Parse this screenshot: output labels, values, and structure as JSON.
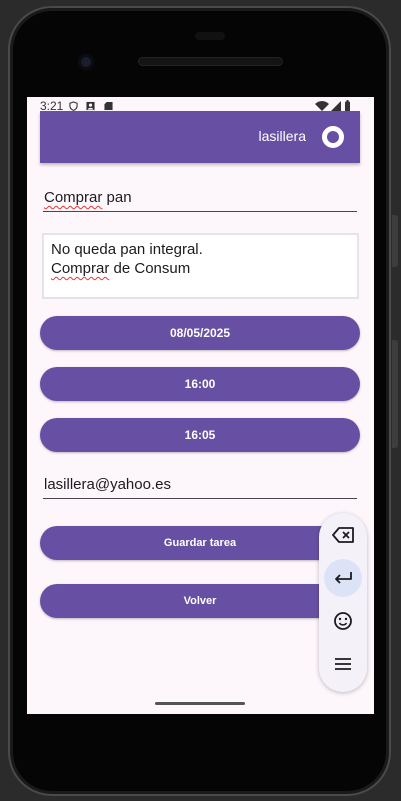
{
  "status_bar": {
    "time": "3:21"
  },
  "app_bar": {
    "username": "lasillera"
  },
  "form": {
    "title_word1": "Comprar",
    "title_word2": " pan",
    "notes_line1": "No queda pan integral.",
    "notes_line2_word1": "Comprar",
    "notes_line2_rest": " de Consum",
    "date": "08/05/2025",
    "time_start": "16:00",
    "time_end": "16:05",
    "email": "lasillera@yahoo.es"
  },
  "actions": {
    "save_label": "Guardar tarea",
    "back_label": "Volver"
  },
  "keyboard_toolbar": {
    "icons": [
      "backspace-icon",
      "enter-icon",
      "emoji-icon",
      "menu-icon"
    ]
  },
  "colors": {
    "primary": "#6750a4",
    "background": "#fdf6fb"
  }
}
